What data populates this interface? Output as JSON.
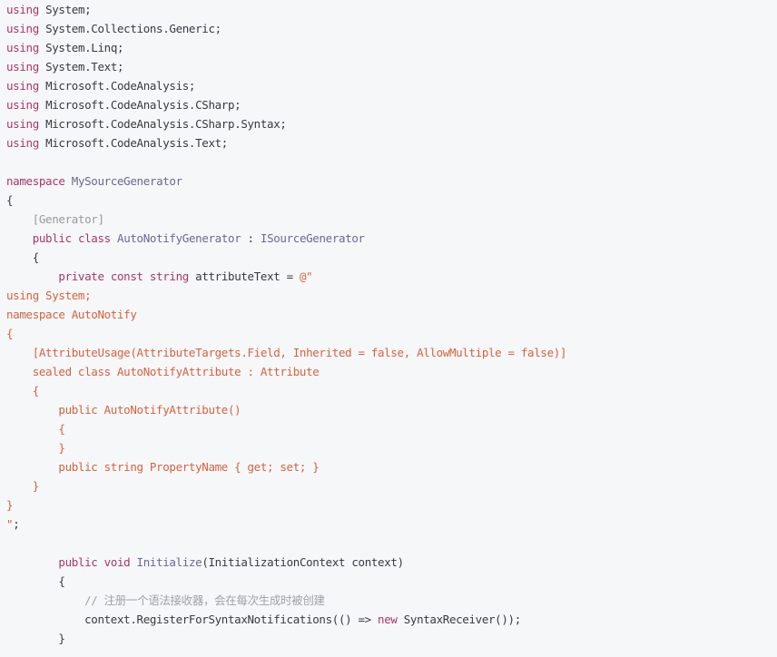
{
  "code": {
    "language": "csharp",
    "lines": [
      [
        {
          "t": "kw",
          "s": "using"
        },
        {
          "t": "pl",
          "s": " System;"
        }
      ],
      [
        {
          "t": "kw",
          "s": "using"
        },
        {
          "t": "pl",
          "s": " System.Collections.Generic;"
        }
      ],
      [
        {
          "t": "kw",
          "s": "using"
        },
        {
          "t": "pl",
          "s": " System.Linq;"
        }
      ],
      [
        {
          "t": "kw",
          "s": "using"
        },
        {
          "t": "pl",
          "s": " System.Text;"
        }
      ],
      [
        {
          "t": "kw",
          "s": "using"
        },
        {
          "t": "pl",
          "s": " Microsoft.CodeAnalysis;"
        }
      ],
      [
        {
          "t": "kw",
          "s": "using"
        },
        {
          "t": "pl",
          "s": " Microsoft.CodeAnalysis.CSharp;"
        }
      ],
      [
        {
          "t": "kw",
          "s": "using"
        },
        {
          "t": "pl",
          "s": " Microsoft.CodeAnalysis.CSharp.Syntax;"
        }
      ],
      [
        {
          "t": "kw",
          "s": "using"
        },
        {
          "t": "pl",
          "s": " Microsoft.CodeAnalysis.Text;"
        }
      ],
      [],
      [
        {
          "t": "kw",
          "s": "namespace"
        },
        {
          "t": "pl",
          "s": " "
        },
        {
          "t": "ty",
          "s": "MySourceGenerator"
        }
      ],
      [
        {
          "t": "pl",
          "s": "{"
        }
      ],
      [
        {
          "t": "pl",
          "s": "    "
        },
        {
          "t": "at",
          "s": "[Generator]"
        }
      ],
      [
        {
          "t": "pl",
          "s": "    "
        },
        {
          "t": "kw",
          "s": "public"
        },
        {
          "t": "pl",
          "s": " "
        },
        {
          "t": "kw",
          "s": "class"
        },
        {
          "t": "pl",
          "s": " "
        },
        {
          "t": "ty",
          "s": "AutoNotifyGenerator"
        },
        {
          "t": "pl",
          "s": " : "
        },
        {
          "t": "ty",
          "s": "ISourceGenerator"
        }
      ],
      [
        {
          "t": "pl",
          "s": "    {"
        }
      ],
      [
        {
          "t": "pl",
          "s": "        "
        },
        {
          "t": "kw",
          "s": "private"
        },
        {
          "t": "pl",
          "s": " "
        },
        {
          "t": "kw",
          "s": "const"
        },
        {
          "t": "pl",
          "s": " "
        },
        {
          "t": "kw",
          "s": "string"
        },
        {
          "t": "pl",
          "s": " attributeText = "
        },
        {
          "t": "st",
          "s": "@\""
        }
      ],
      [
        {
          "t": "st",
          "s": "using System;"
        }
      ],
      [
        {
          "t": "st",
          "s": "namespace AutoNotify"
        }
      ],
      [
        {
          "t": "st",
          "s": "{"
        }
      ],
      [
        {
          "t": "st",
          "s": "    [AttributeUsage(AttributeTargets.Field, Inherited = false, AllowMultiple = false)]"
        }
      ],
      [
        {
          "t": "st",
          "s": "    sealed class AutoNotifyAttribute : Attribute"
        }
      ],
      [
        {
          "t": "st",
          "s": "    {"
        }
      ],
      [
        {
          "t": "st",
          "s": "        public AutoNotifyAttribute()"
        }
      ],
      [
        {
          "t": "st",
          "s": "        {"
        }
      ],
      [
        {
          "t": "st",
          "s": "        }"
        }
      ],
      [
        {
          "t": "st",
          "s": "        public string PropertyName { get; set; }"
        }
      ],
      [
        {
          "t": "st",
          "s": "    }"
        }
      ],
      [
        {
          "t": "st",
          "s": "}"
        }
      ],
      [
        {
          "t": "st",
          "s": "\""
        },
        {
          "t": "pl",
          "s": ";"
        }
      ],
      [],
      [
        {
          "t": "pl",
          "s": "        "
        },
        {
          "t": "kw",
          "s": "public"
        },
        {
          "t": "pl",
          "s": " "
        },
        {
          "t": "kw",
          "s": "void"
        },
        {
          "t": "pl",
          "s": " "
        },
        {
          "t": "ty",
          "s": "Initialize"
        },
        {
          "t": "pl",
          "s": "(InitializationContext context)"
        }
      ],
      [
        {
          "t": "pl",
          "s": "        {"
        }
      ],
      [
        {
          "t": "pl",
          "s": "            "
        },
        {
          "t": "cm",
          "s": "// 注册一个语法接收器，会在每次生成时被创建"
        }
      ],
      [
        {
          "t": "pl",
          "s": "            context.RegisterForSyntaxNotifications(() => "
        },
        {
          "t": "kw",
          "s": "new"
        },
        {
          "t": "pl",
          "s": " SyntaxReceiver());"
        }
      ],
      [
        {
          "t": "pl",
          "s": "        }"
        }
      ]
    ]
  }
}
